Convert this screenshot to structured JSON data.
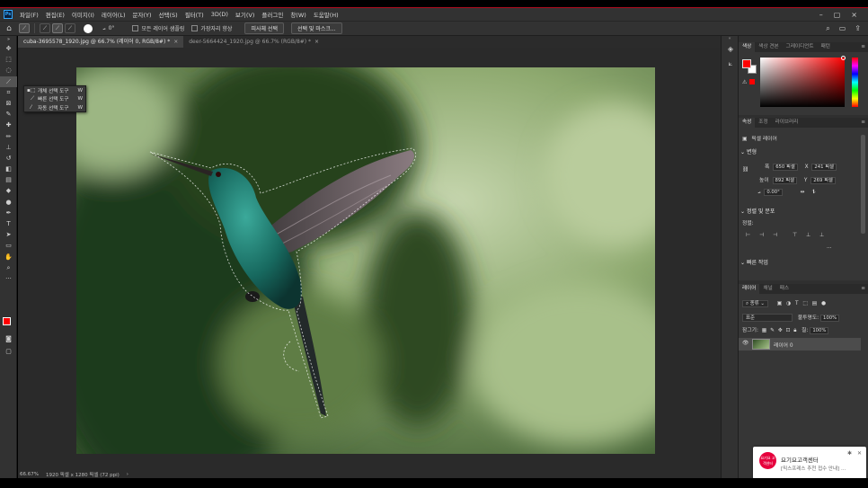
{
  "menubar": {
    "logo": "Ps",
    "items": [
      "파일(F)",
      "편집(E)",
      "이미지(I)",
      "레이어(L)",
      "문자(Y)",
      "선택(S)",
      "필터(T)",
      "3D(D)",
      "보기(V)",
      "플러그인",
      "창(W)",
      "도움말(H)"
    ],
    "window_controls": [
      "–",
      "▢",
      "×"
    ]
  },
  "options": {
    "home_icon": "home-icon",
    "angle": "0°",
    "sample_all_layers_label": "모든 레이어 샘플링",
    "hard_edge_label": "가장자리 향상",
    "select_subject_label": "피사체 선택",
    "select_mask_label": "선택 및 마스크..."
  },
  "tabs": [
    {
      "label": "cuba-3695578_1920.jpg @ 66.7% (레이어 0, RGB/8#) *",
      "active": true,
      "close": "×"
    },
    {
      "label": "deer-5664424_1920.jpg @ 66.7% (RGB/8#) *",
      "active": false,
      "close": "×"
    }
  ],
  "flyout": {
    "items": [
      {
        "label": "개체 선택 도구",
        "shortcut": "W",
        "current": true
      },
      {
        "label": "빠른 선택 도구",
        "shortcut": "W",
        "current": false
      },
      {
        "label": "자동 선택 도구",
        "shortcut": "W",
        "current": false
      }
    ]
  },
  "status": {
    "zoom": "66.67%",
    "info": "1920 픽셀 x 1280 픽셀 (72 ppi)"
  },
  "color_panel": {
    "tabs": [
      "색상",
      "색상 견본",
      "그레이디언트",
      "패턴"
    ],
    "fg_color": "#ff0000",
    "bg_color": "#ffffff"
  },
  "properties_panel": {
    "tabs": [
      "속성",
      "조정",
      "라이브러리"
    ],
    "layer_type": "픽셀 레이어",
    "transform_title": "변형",
    "width_label": "폭",
    "width_value": "650 픽셀",
    "x_label": "X",
    "x_value": "241 픽셀",
    "height_label": "높이",
    "height_value": "892 픽셀",
    "y_label": "Y",
    "y_value": "269 픽셀",
    "angle_value": "0.00°",
    "align_title": "정렬 및 분포",
    "align_label": "정렬:",
    "quick_actions_title": "빠른 작업",
    "more": "..."
  },
  "layers_panel": {
    "tabs": [
      "레이어",
      "채널",
      "패스"
    ],
    "filter_kind": "종류",
    "blend_mode": "표준",
    "opacity_label": "불투명도:",
    "opacity_value": "100%",
    "lock_label": "잠그기:",
    "fill_label": "칠:",
    "fill_value": "100%",
    "layers": [
      {
        "name": "레이어 0",
        "visible": true
      }
    ]
  },
  "notification": {
    "logo_text": "요기요 고객센터",
    "title": "요기요고객센터",
    "subtitle": "[믹스프레스 추천 접수 안내] ..."
  }
}
